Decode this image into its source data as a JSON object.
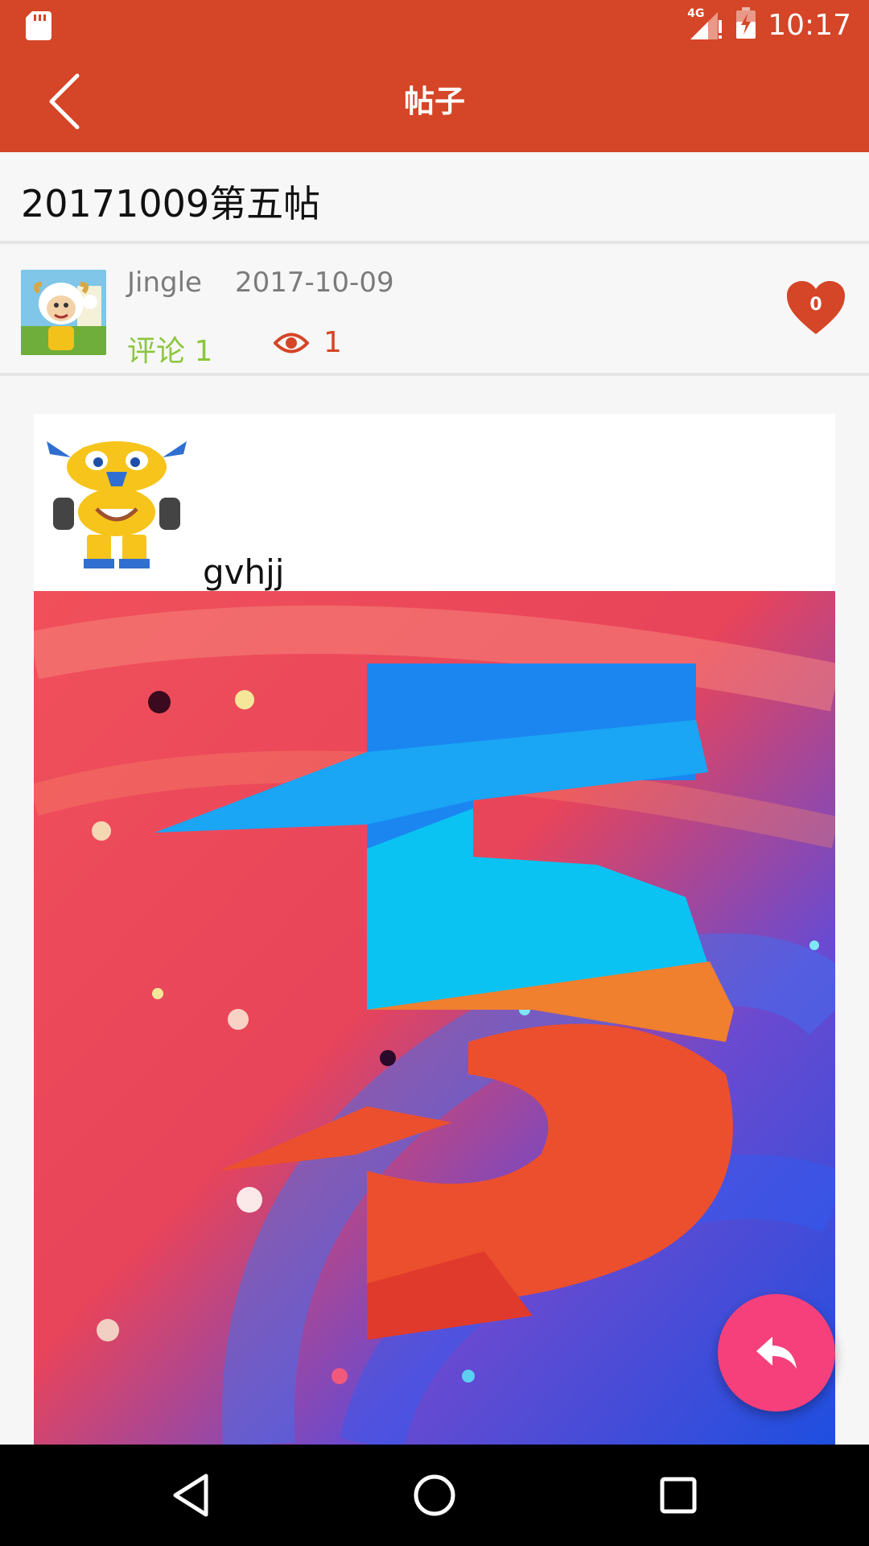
{
  "status_bar": {
    "time": "10:17",
    "network": "4G",
    "icons": [
      "sd-card-icon",
      "signal-icon",
      "battery-icon"
    ]
  },
  "toolbar": {
    "title": "帖子",
    "back_icon": "chevron-left-icon"
  },
  "post": {
    "title": "20171009第五帖",
    "author": "Jingle",
    "date": "2017-10-09",
    "comments_label": "评论 1",
    "views_count": "1",
    "likes_count": "0"
  },
  "content": {
    "text": "gvhjj",
    "emoji_icon": "robot-emoji-icon",
    "image_icon": "number-five-artwork"
  },
  "fab": {
    "icon": "reply-icon"
  },
  "nav_bar": {
    "buttons": [
      "back-triangle-icon",
      "home-circle-icon",
      "recents-square-icon"
    ]
  },
  "colors": {
    "primary": "#d54527",
    "comment_green": "#8cc63f",
    "fab_pink": "#f5407b"
  }
}
